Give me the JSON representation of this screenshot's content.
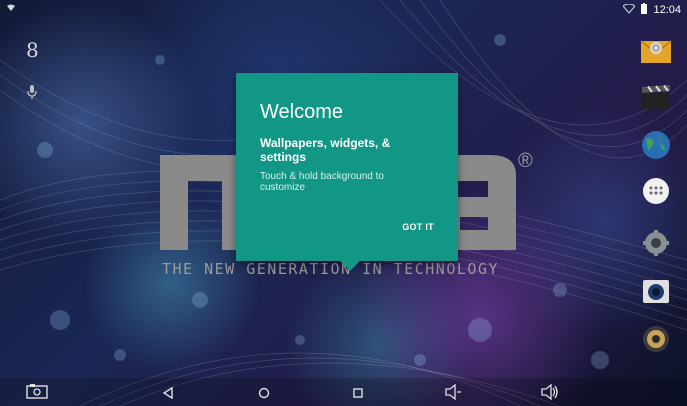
{
  "status_bar": {
    "time": "12:04",
    "icons": [
      "notification-icon",
      "wifi-icon",
      "battery-icon"
    ]
  },
  "wallpaper": {
    "tagline": "THE NEW GENERATION IN TECHNOLOGY",
    "registered_mark": "®"
  },
  "left_rail": {
    "google_search_glyph": "8",
    "icons": [
      "google-search-icon",
      "microphone-icon"
    ]
  },
  "welcome_dialog": {
    "title": "Welcome",
    "subtitle": "Wallpapers, widgets, & settings",
    "body": "Touch & hold background to customize",
    "button_label": "GOT IT",
    "background_color": "#129686"
  },
  "dock": {
    "items": [
      "email-app-icon",
      "video-app-icon",
      "browser-app-icon",
      "all-apps-icon",
      "settings-app-icon",
      "camera-app-icon",
      "music-app-icon"
    ]
  },
  "nav_bar": {
    "items": [
      "screenshot-icon",
      "back-icon",
      "home-icon",
      "recents-icon",
      "volume-down-icon",
      "volume-up-icon"
    ]
  }
}
